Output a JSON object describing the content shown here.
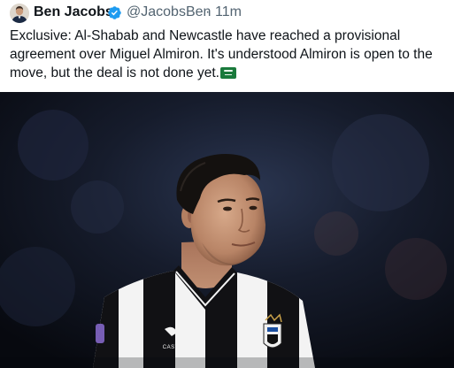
{
  "tweet": {
    "author": {
      "display_name": "Ben Jacobs",
      "handle": "@JacobsBen",
      "verified": true
    },
    "separator": "·",
    "timestamp": "11m",
    "text_lines": [
      "Exclusive: Al-Shabab and Newcastle have reached a provisional",
      "agreement over Miguel Almiron. It's understood Almiron is open to the",
      "move, but the deal is not done yet."
    ],
    "emoji": "saudi-arabia-flag",
    "media": {
      "kit_brand": "CASTORE"
    }
  },
  "colors": {
    "text_primary": "#0f1419",
    "text_secondary": "#536471",
    "verified_blue": "#1d9bf0",
    "flag_green": "#1a7a3c"
  }
}
